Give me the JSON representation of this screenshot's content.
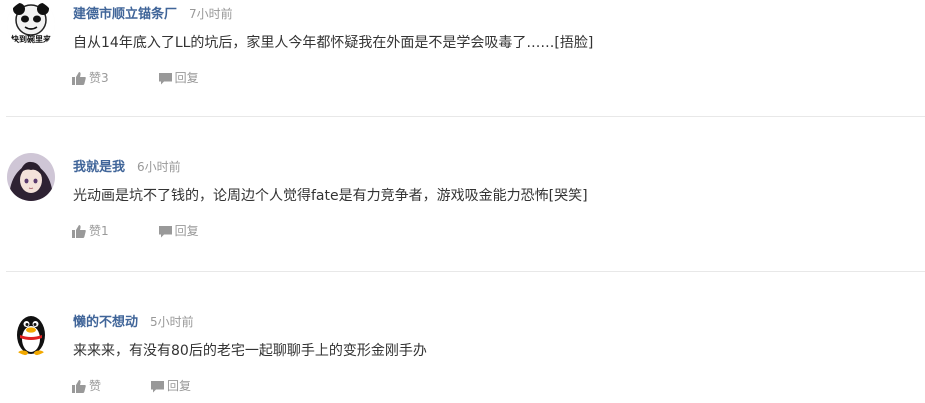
{
  "colors": {
    "username": "#406599",
    "meta": "#999999",
    "text": "#333333",
    "divider": "#e8e8e8"
  },
  "comments": [
    {
      "avatar_icon": "meme-panda-face-avatar",
      "avatar_caption": "快到碗里来",
      "username": "建德市顺立锚条厂",
      "time": "7小时前",
      "text": "自从14年底入了LL的坑后，家里人今年都怀疑我在外面是不是学会吸毒了……[捂脸]",
      "like_label": "赞3",
      "reply_label": "回复"
    },
    {
      "avatar_icon": "anime-character-avatar",
      "username": "我就是我",
      "time": "6小时前",
      "text": "光动画是坑不了钱的，论周边个人觉得fate是有力竞争者，游戏吸金能力恐怖[哭笑]",
      "like_label": "赞1",
      "reply_label": "回复"
    },
    {
      "avatar_icon": "qq-penguin-avatar",
      "username": "懒的不想动",
      "time": "5小时前",
      "text": "来来来，有没有80后的老宅一起聊聊手上的变形金刚手办",
      "like_label": "赞",
      "reply_label": "回复"
    }
  ]
}
